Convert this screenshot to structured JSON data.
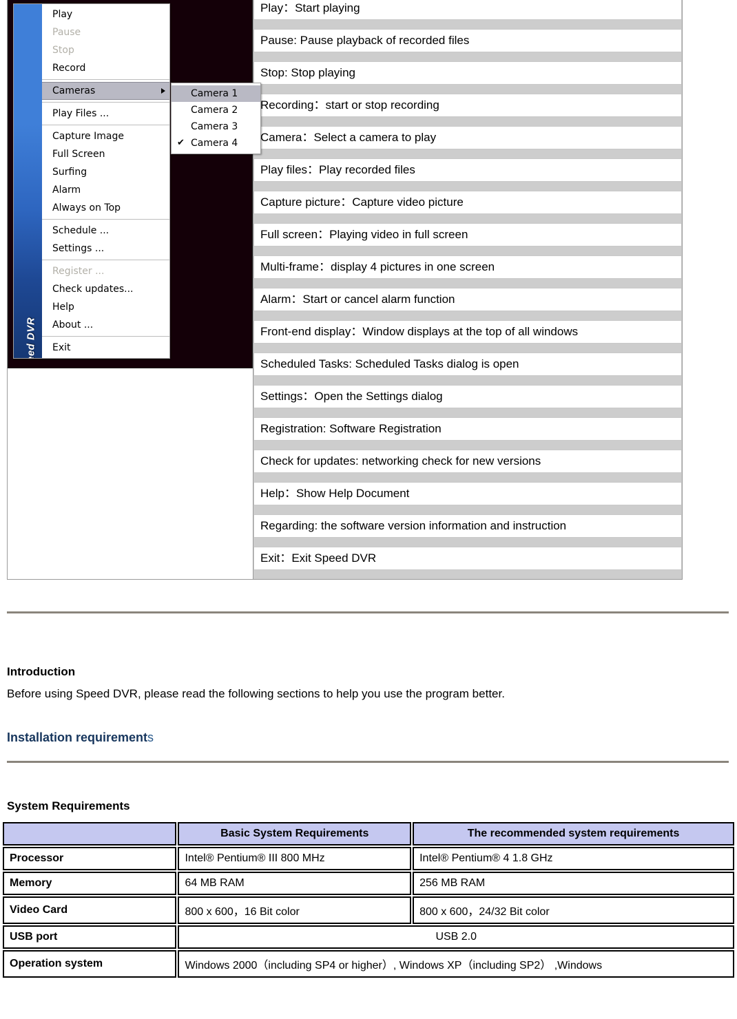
{
  "app": {
    "name": "Speed DVR",
    "gutter_label": "Speed  DVR"
  },
  "context_menu": {
    "items": [
      {
        "label": "Play",
        "state": "enabled"
      },
      {
        "label": "Pause",
        "state": "disabled"
      },
      {
        "label": "Stop",
        "state": "disabled"
      },
      {
        "label": "Record",
        "state": "enabled"
      },
      {
        "label": "Cameras",
        "state": "highlighted",
        "has_submenu": true
      },
      {
        "label": "Play Files ...",
        "state": "enabled"
      },
      {
        "label": "Capture Image",
        "state": "enabled"
      },
      {
        "label": "Full Screen",
        "state": "enabled"
      },
      {
        "label": "Surfing",
        "state": "enabled"
      },
      {
        "label": "Alarm",
        "state": "enabled"
      },
      {
        "label": "Always on Top",
        "state": "enabled"
      },
      {
        "label": "Schedule ...",
        "state": "enabled"
      },
      {
        "label": "Settings ...",
        "state": "enabled"
      },
      {
        "label": "Register ...",
        "state": "disabled"
      },
      {
        "label": "Check updates...",
        "state": "enabled"
      },
      {
        "label": "Help",
        "state": "enabled"
      },
      {
        "label": "About ...",
        "state": "enabled"
      },
      {
        "label": "Exit",
        "state": "enabled"
      }
    ],
    "submenu": {
      "items": [
        {
          "label": "Camera 1",
          "highlighted": true,
          "checked": false
        },
        {
          "label": "Camera 2",
          "highlighted": false,
          "checked": false
        },
        {
          "label": "Camera 3",
          "highlighted": false,
          "checked": false
        },
        {
          "label": "Camera 4",
          "highlighted": false,
          "checked": true
        }
      ],
      "check_glyph": "✔"
    }
  },
  "descriptions": [
    "Play：Start playing",
    "Pause: Pause playback of recorded files",
    "Stop: Stop playing",
    "Recording：start or stop recording",
    "Camera：Select a camera to play",
    "Play files：Play recorded files",
    "Capture picture：Capture video picture",
    "Full screen：Playing video in full screen",
    "Multi-frame：display 4 pictures in one screen",
    "Alarm：Start or cancel alarm function",
    "Front-end display：Window displays at the top of all windows",
    "Scheduled Tasks: Scheduled Tasks dialog is open",
    "Settings：Open the Settings dialog",
    "Registration: Software Registration",
    "Check for updates: networking check for new versions",
    "Help：Show Help Document",
    "Regarding: the software version information and instruction",
    "Exit：Exit Speed DVR"
  ],
  "sections": {
    "introduction": {
      "heading": "Introduction",
      "body": "Before using Speed DVR, please read the following sections to help you use the program better."
    },
    "installation": {
      "heading_main": "Installation requirement",
      "heading_tail": "s"
    },
    "system_requirements": {
      "heading": "System Requirements"
    }
  },
  "sys_table": {
    "headers": [
      "",
      "Basic System Requirements",
      "The recommended system requirements"
    ],
    "rows": [
      {
        "label": "Processor",
        "basic": "Intel® Pentium® III 800 MHz",
        "recommended": "Intel® Pentium® 4 1.8 GHz",
        "span": false
      },
      {
        "label": "Memory",
        "basic": "64 MB RAM",
        "recommended": "256 MB RAM",
        "span": false
      },
      {
        "label": "Video Card",
        "basic": "800 x 600，16 Bit color",
        "recommended": "800 x 600，24/32 Bit color",
        "span": false
      },
      {
        "label": "USB port",
        "basic": "USB 2.0",
        "recommended": "",
        "span": true
      },
      {
        "label": "Operation system",
        "basic": "Windows 2000（including SP4 or higher）, Windows XP（including SP2） ,Windows",
        "recommended": "",
        "span": true
      }
    ]
  },
  "colors": {
    "accent_blue": "#17365d",
    "header_lavender": "#c5c8f0",
    "menu_highlight": "#b9b9c4",
    "separator_gray": "#cdcdcd",
    "rule_gray": "#8a857c",
    "screenshot_bg": "#140008"
  }
}
